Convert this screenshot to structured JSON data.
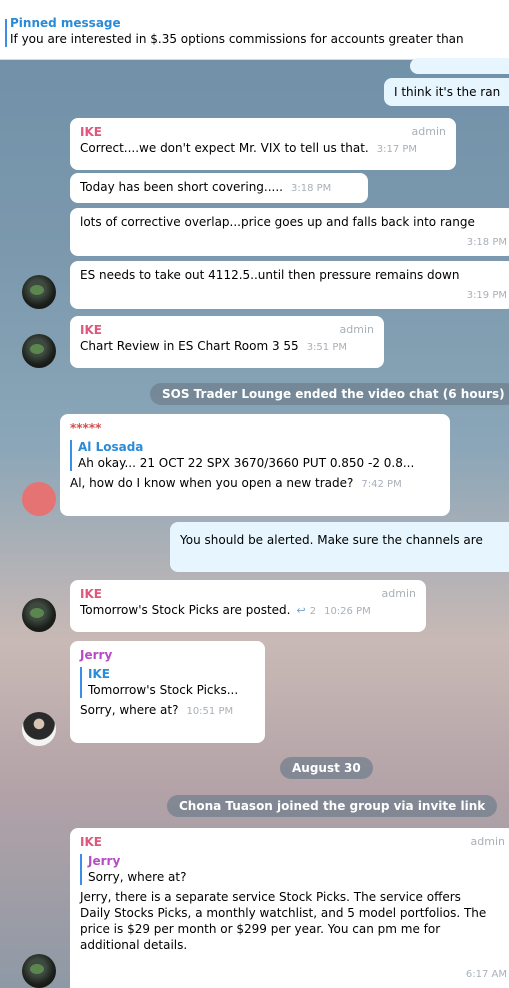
{
  "pinned": {
    "title": "Pinned message",
    "text": "If you are interested in $.35 options commissions for accounts greater than"
  },
  "messages": {
    "m0": {
      "text": "I think it's the ran"
    },
    "m1": {
      "sender": "IKE",
      "admin": "admin",
      "text": "Correct....we don't expect Mr. VIX to tell us that.",
      "time": "3:17 PM"
    },
    "m2": {
      "text": "Today has been short covering.....",
      "time": "3:18 PM"
    },
    "m3": {
      "text": "lots of corrective overlap...price goes up and falls back into range",
      "time": "3:18 PM"
    },
    "m4": {
      "text": "ES needs to take out 4112.5..until then pressure remains down",
      "time": "3:19 PM"
    },
    "m5": {
      "sender": "IKE",
      "admin": "admin",
      "text": "Chart Review in ES Chart Room  3 55",
      "time": "3:51 PM"
    },
    "s1": {
      "text": "SOS Trader Lounge ended the video chat (6 hours)"
    },
    "m6": {
      "sender": "*****",
      "reply_name": "Al Losada",
      "reply_text": "Ah okay...  21 OCT 22 SPX 3670/3660 PUT 0.850 -2 0.8...",
      "text": "Al, how do I know when you open a new trade?",
      "time": "7:42 PM"
    },
    "m7": {
      "text": "You should be alerted. Make sure the channels are"
    },
    "m8": {
      "sender": "IKE",
      "admin": "admin",
      "text": "Tomorrow's Stock Picks are posted.",
      "forwards": "2",
      "time": "10:26 PM"
    },
    "m9": {
      "sender": "Jerry",
      "reply_name": "IKE",
      "reply_text": "Tomorrow's Stock Picks...",
      "text": "Sorry, where at?",
      "time": "10:51 PM"
    },
    "s2": {
      "text": "August 30"
    },
    "s3": {
      "text": "Chona Tuason joined the group via invite link"
    },
    "m10": {
      "sender": "IKE",
      "admin": "admin",
      "reply_name": "Jerry",
      "reply_text": "Sorry, where at?",
      "lines": [
        "Jerry, there is a separate service Stock Picks. The service offers",
        "Daily Stocks Picks, a monthly watchlist, and 5 model portfolios. The",
        "price is $29 per month or $299 per year. You can pm me for",
        "additional details."
      ],
      "time": "6:17 AM"
    }
  },
  "colors": {
    "accent": "#2a8bd8",
    "sender_pink": "#e0577d",
    "outgoing_bg": "#e7f6fe"
  }
}
